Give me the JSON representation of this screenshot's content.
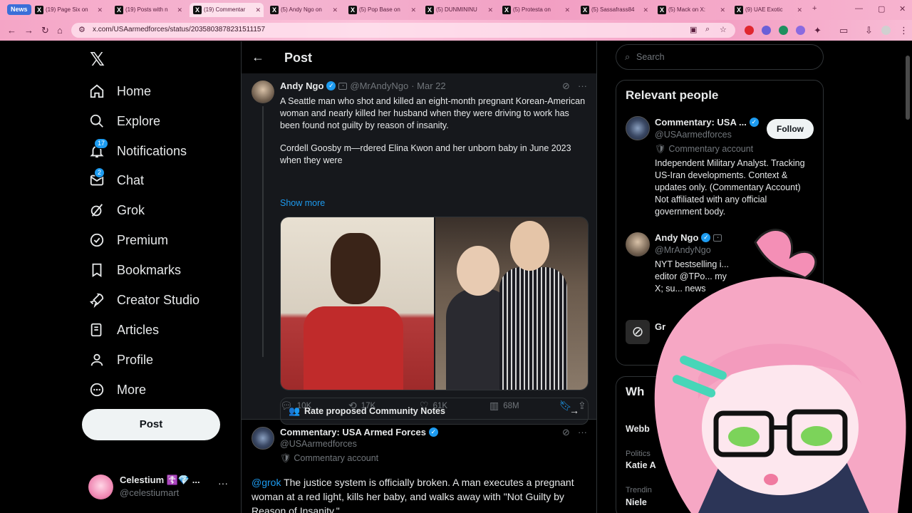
{
  "browser": {
    "news_badge": "News",
    "tabs": [
      {
        "label": "(19) Page Six on"
      },
      {
        "label": "(19) Posts with n"
      },
      {
        "label": "(19) Commentar"
      },
      {
        "label": "(5) Andy Ngo on"
      },
      {
        "label": "(5) Pop Base on"
      },
      {
        "label": "(5) DUNMININU"
      },
      {
        "label": "(5) Protesta on"
      },
      {
        "label": "(5) Sassafrass84"
      },
      {
        "label": "(5) Mack on X:"
      },
      {
        "label": "(9) UAE Exotic"
      }
    ],
    "url": "x.com/USAarmedforces/status/2035803878231511157"
  },
  "nav": {
    "items": [
      {
        "label": "Home",
        "icon": "home-icon"
      },
      {
        "label": "Explore",
        "icon": "search-icon"
      },
      {
        "label": "Notifications",
        "icon": "bell-icon",
        "badge": "17"
      },
      {
        "label": "Chat",
        "icon": "mail-icon",
        "badge": "2"
      },
      {
        "label": "Grok",
        "icon": "grok-icon"
      },
      {
        "label": "Premium",
        "icon": "verified-badge-icon"
      },
      {
        "label": "Bookmarks",
        "icon": "bookmark-icon"
      },
      {
        "label": "Creator Studio",
        "icon": "rocket-icon"
      },
      {
        "label": "Articles",
        "icon": "article-icon"
      },
      {
        "label": "Profile",
        "icon": "person-icon"
      },
      {
        "label": "More",
        "icon": "more-circle-icon"
      }
    ],
    "post_button": "Post",
    "account": {
      "name": "Celestium ☦️💎 ...",
      "handle": "@celestiumart"
    }
  },
  "header": {
    "title": "Post"
  },
  "quoted_post": {
    "author": "Andy Ngo",
    "handle": "@MrAndyNgo",
    "date": "· Mar 22",
    "text_p1": "A Seattle man who shot and killed an eight-month pregnant Korean-American woman and nearly killed her husband when they were driving to work has been found not guilty by reason of insanity.",
    "text_p2": "Cordell Goosby m—rdered Elina Kwon and her unborn baby in June 2023 when they were",
    "show_more": "Show more",
    "community_notes": "Rate proposed Community Notes",
    "replies": "10K",
    "reposts": "17K",
    "likes": "61K",
    "views": "68M"
  },
  "reply_post": {
    "author": "Commentary: USA Armed Forces",
    "handle": "@USAarmedforces",
    "label": "Commentary account",
    "mention": "@grok",
    "text": " The justice system is officially broken. A man executes a pregnant woman at a red light, kills her baby, and walks away with \"Not Guilty by Reason of Insanity.\""
  },
  "sidebar": {
    "search_placeholder": "Search",
    "relevant_title": "Relevant people",
    "person1": {
      "name": "Commentary: USA ...",
      "handle": "@USAarmedforces",
      "label": "Commentary account",
      "bio": "Independent Military Analyst. Tracking US-Iran developments. Context & updates only. (Commentary Account) Not affiliated with any official government body.",
      "follow": "Follow"
    },
    "person2": {
      "name": "Andy Ngo",
      "handle": "@MrAndyNgo",
      "bio": "NYT bestselling i... editor @TPo... my X; su... news"
    },
    "person3": {
      "name": "Gr"
    },
    "whats_title": "Wh",
    "trend1_main": "Webb",
    "trend2_cat": "Politics",
    "trend2_main": "Katie A",
    "trend3_cat": "Trendin",
    "trend3_main": "Niele"
  },
  "colors": {
    "accent": "#1d9bf0",
    "bg": "#000000",
    "border": "#2f3336"
  }
}
